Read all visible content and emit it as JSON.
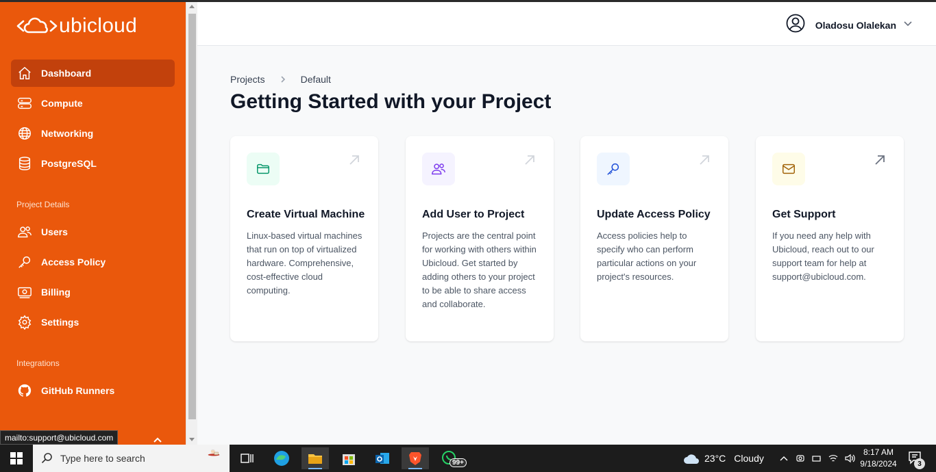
{
  "brand": {
    "name": "ubicloud",
    "color": "#ea580c",
    "active_color": "#c2410c"
  },
  "sidebar": {
    "main_items": [
      {
        "label": "Dashboard",
        "icon": "home-icon",
        "active": true
      },
      {
        "label": "Compute",
        "icon": "server-icon"
      },
      {
        "label": "Networking",
        "icon": "globe-icon"
      },
      {
        "label": "PostgreSQL",
        "icon": "database-icon"
      }
    ],
    "project_section_label": "Project Details",
    "project_items": [
      {
        "label": "Users",
        "icon": "users-icon"
      },
      {
        "label": "Access Policy",
        "icon": "key-icon"
      },
      {
        "label": "Billing",
        "icon": "billing-icon"
      },
      {
        "label": "Settings",
        "icon": "gear-icon"
      }
    ],
    "integrations_section_label": "Integrations",
    "integration_items": [
      {
        "label": "GitHub Runners",
        "icon": "github-icon"
      }
    ]
  },
  "header": {
    "user_name": "Oladosu Olalekan"
  },
  "breadcrumb": {
    "items": [
      "Projects",
      "Default"
    ]
  },
  "page": {
    "title": "Getting Started with your Project"
  },
  "cards": [
    {
      "title": "Create Virtual Machine",
      "description": "Linux-based virtual machines that run on top of virtualized hardware. Comprehensive, cost-effective cloud computing.",
      "icon": "folder-icon",
      "badge_bg": "#ecfdf5",
      "icon_color": "#059669"
    },
    {
      "title": "Add User to Project",
      "description": "Projects are the central point for working with others within Ubicloud. Get started by adding others to your project to be able to share access and collaborate.",
      "icon": "users-icon",
      "badge_bg": "#f5f3ff",
      "icon_color": "#7c3aed"
    },
    {
      "title": "Update Access Policy",
      "description": "Access policies help to specify who can perform particular actions on your project's resources.",
      "icon": "key-icon",
      "badge_bg": "#eff6ff",
      "icon_color": "#1d4ed8"
    },
    {
      "title": "Get Support",
      "description": "If you need any help with Ubicloud, reach out to our support team for help at support@ubicloud.com.",
      "icon": "mail-icon",
      "badge_bg": "#fefce8",
      "icon_color": "#a16207"
    }
  ],
  "status_bar": {
    "link": "mailto:support@ubicloud.com"
  },
  "taskbar": {
    "search_placeholder": "Type here to search",
    "weather_temp": "23°C",
    "weather_condition": "Cloudy",
    "time": "8:17 AM",
    "date": "9/18/2024",
    "notification_count": "3",
    "whatsapp_badge": "99+"
  }
}
